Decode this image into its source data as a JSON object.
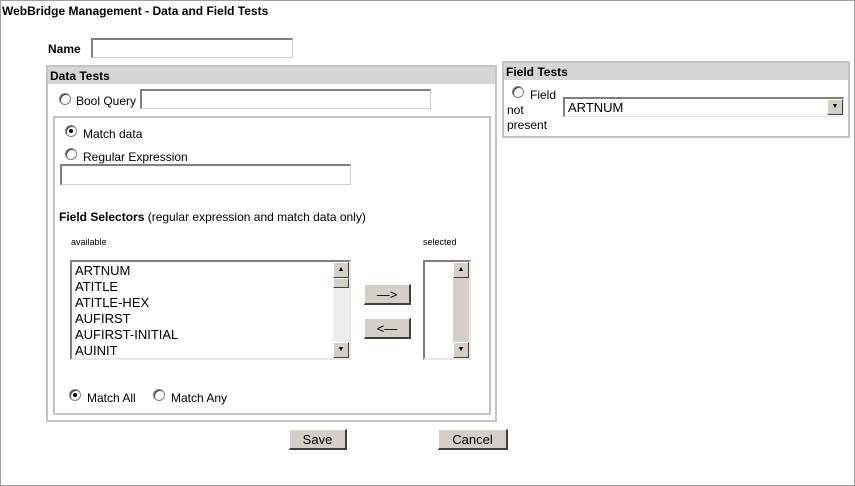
{
  "window": {
    "title": "WebBridge Management - Data and Field Tests"
  },
  "name_field": {
    "label": "Name",
    "value": ""
  },
  "data_tests": {
    "heading": "Data Tests",
    "bool_query": {
      "label": "Bool Query",
      "value": "",
      "selected": false
    },
    "match_data": {
      "label": "Match data",
      "selected": true
    },
    "regular_expression": {
      "label": "Regular Expression",
      "selected": false,
      "value": ""
    },
    "field_selectors": {
      "title": "Field Selectors",
      "note": "(regular expression and match data only)",
      "available_label": "available",
      "selected_label": "selected",
      "available_items": [
        "ARTNUM",
        "ATITLE",
        "ATITLE-HEX",
        "AUFIRST",
        "AUFIRST-INITIAL",
        "AUINIT"
      ],
      "selected_items": [],
      "add_label": "—>",
      "remove_label": "<—"
    },
    "match_all": {
      "label": "Match All",
      "selected": true
    },
    "match_any": {
      "label": "Match Any",
      "selected": false
    }
  },
  "field_tests": {
    "heading": "Field Tests",
    "field_not_present_line1": "Field",
    "field_not_present_line2": "not",
    "field_not_present_line3": "present",
    "field_not_present_selected": false,
    "field_select_value": "ARTNUM"
  },
  "actions": {
    "save_label": "Save",
    "cancel_label": "Cancel"
  },
  "icons": {
    "scroll_up": "▲",
    "scroll_down": "▼",
    "dropdown": "▼"
  }
}
